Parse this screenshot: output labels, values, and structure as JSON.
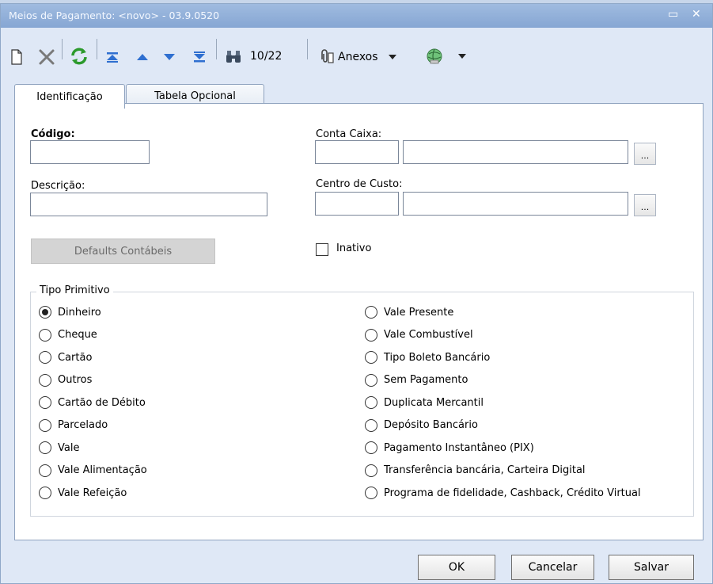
{
  "window": {
    "title": "Meios de Pagamento: <novo> - 03.9.0520",
    "minimize_glyph": "▭",
    "close_glyph": "✕"
  },
  "toolbar": {
    "counter": "10/22",
    "anexos_label": "Anexos",
    "icons": [
      "new-document-icon",
      "delete-icon",
      "refresh-icon",
      "first-record-icon",
      "previous-record-icon",
      "next-record-icon",
      "last-record-icon",
      "binoculars-icon",
      "paperclip-icon",
      "dropdown-arrow-icon",
      "globe-icon"
    ],
    "accent_green": "#2c9a2c",
    "accent_blue": "#2f6fd0"
  },
  "tabs": [
    {
      "label": "Identificação",
      "active": true
    },
    {
      "label": "Tabela Opcional",
      "active": false
    }
  ],
  "form": {
    "codigo_label": "Código:",
    "codigo_value": "",
    "descricao_label": "Descrição:",
    "descricao_value": "",
    "conta_caixa_label": "Conta Caixa:",
    "centro_custo_label": "Centro de Custo:",
    "ellipsis": "...",
    "defaults_button": "Defaults Contábeis",
    "inativo_label": "Inativo",
    "inativo_checked": false
  },
  "tipo_primitivo": {
    "legend": "Tipo Primitivo",
    "selected": "Dinheiro",
    "left": [
      "Dinheiro",
      "Cheque",
      "Cartão",
      "Outros",
      "Cartão de Débito",
      "Parcelado",
      "Vale",
      "Vale Alimentação",
      "Vale Refeição"
    ],
    "right": [
      "Vale Presente",
      "Vale Combustível",
      "Tipo Boleto Bancário",
      "Sem Pagamento",
      "Duplicata Mercantil",
      "Depósito Bancário",
      "Pagamento Instantâneo (PIX)",
      "Transferência bancária, Carteira Digital",
      "Programa de fidelidade, Cashback, Crédito Virtual"
    ]
  },
  "footer": {
    "ok": "OK",
    "cancelar": "Cancelar",
    "salvar": "Salvar"
  }
}
